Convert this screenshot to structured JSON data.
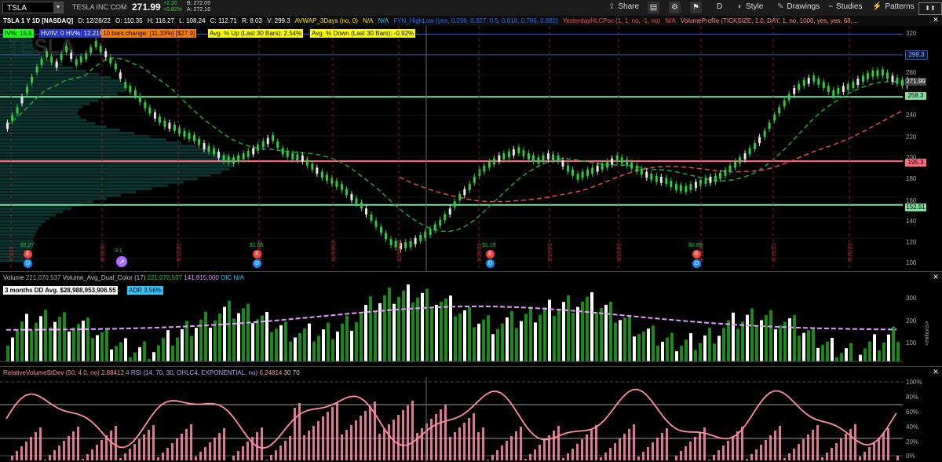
{
  "toolbar": {
    "symbol": "TSLA",
    "company": "TESLA INC COM",
    "last": "271.99",
    "change_abs": "+2.20",
    "change_pct": "+0.82%",
    "bid": "B: 272.09",
    "ask": "A: 272.16",
    "share": "Share",
    "period": "D",
    "style": "Style",
    "drawings": "Drawings",
    "studies": "Studies",
    "patterns": "Patterns"
  },
  "header": {
    "title": "TSLA 1 Y 1D [NASDAQ]",
    "date": "D: 12/28/22",
    "open": "O: 110.35",
    "high": "H: 116.27",
    "low": "L: 108.24",
    "close": "C: 112.71",
    "range": "R: 8.03",
    "volume": "V: 299.3",
    "avwap": "AVWAP_3Days (no, 0)",
    "avwap_val": "N/A",
    "na2": "N/A",
    "fib": "FYN_HighLow (yes, 0.236, 0.327, 0.5, 0.618, 0.786, 0.882)",
    "yhlc": "YesterdayHLCPoc (1, 1, no, -1, no)",
    "yhlc_val": "N/A",
    "vp": "VolumeProfile (TICKSIZE, 1.0, DAY, 1, no, 1000, yes, yes, 68,..."
  },
  "labels": {
    "iv": "IV%: 15.5",
    "hist1": "HV/IV: 0.7",
    "hist2": "HV%: 12.21%",
    "bars10": "10 bars change: [11.33%] [$27.9]",
    "avg_up": "Avg. % Up (Last 30 Bars): 2.54%",
    "avg_down": "Avg. % Down (Last 30 Bars): -0.92%",
    "watermark": "TESLA"
  },
  "price_axis": {
    "ticks": [
      "320",
      "280",
      "240",
      "220",
      "200",
      "180",
      "160",
      "140",
      "120",
      "100"
    ],
    "tags": {
      "t299": "299.3",
      "t272": "271.99",
      "t258": "258.3",
      "t195": "195.3",
      "t152": "152.51"
    }
  },
  "date_labels": [
    "7/1/22",
    "8/19/22",
    "9/12/22",
    "10/20/22",
    "11/18/22",
    "12/16/22",
    "1/20/23",
    "2/17/23",
    "3/17/23",
    "4/19/23",
    "5/19/23",
    "6/16/23"
  ],
  "events": {
    "div1": "$2.27",
    "div2": "$1.05",
    "div3": "$1.19",
    "div4": "$0.85",
    "split": "3:1"
  },
  "volume_panel": {
    "title": "Volume",
    "value": "221,070,537",
    "avg_label": "Volume_Avg_Dual_Color (17)",
    "avg_val1": "221,070,537",
    "avg_val2": "141,815,000",
    "oic": "OIC",
    "oic_val": "N/A",
    "dd_avg": "3 months DD Avg. $28,988,953,906.55",
    "adr": "ADR 3.56%",
    "ticks": [
      "300",
      "200",
      "100"
    ],
    "unit": "<millions>"
  },
  "rsi_panel": {
    "rvsd": "RelativeVolumeStDev (50, 4.0, no)",
    "rvsd_val": "2.88412",
    "rvsd_n": "4",
    "rsi": "RSI (14, 70, 30, OHLC4, EXPONENTIAL, no)",
    "rsi_val": "6.24814",
    "ob": "30",
    "os": "70",
    "ticks": [
      "100%",
      "80%",
      "60%",
      "40%",
      "20%",
      "0%"
    ]
  },
  "colors": {
    "up": "#2ecc40",
    "down": "#e8e8e8",
    "support": "#7fe0a0",
    "resistance": "#ff6b7a",
    "rsi_pink": "#ff8fa3",
    "rsi_cyan": "#4fd8ff",
    "rsi_violet": "#b8a8ff"
  }
}
